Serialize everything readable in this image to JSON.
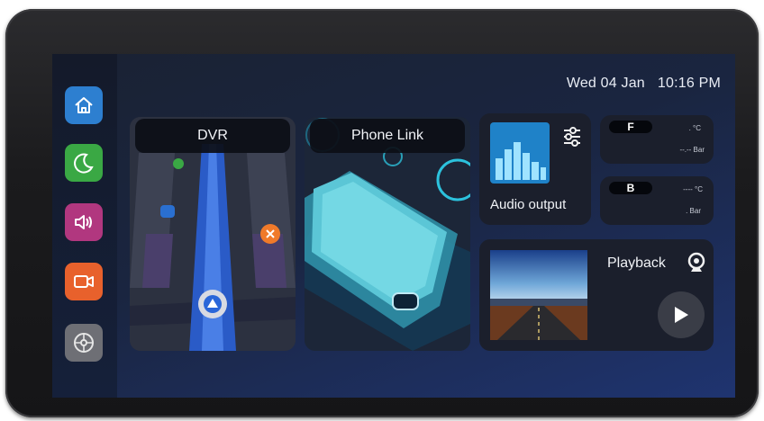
{
  "header": {
    "date": "Wed 04 Jan",
    "time": "10:16 PM"
  },
  "sidebar": {
    "items": [
      {
        "name": "home",
        "icon": "home-icon",
        "color": "#2d7fd0"
      },
      {
        "name": "night-mode",
        "icon": "moon-icon",
        "color": "#3aa844"
      },
      {
        "name": "sound",
        "icon": "speaker-icon",
        "color": "#b1377f"
      },
      {
        "name": "camera",
        "icon": "video-camera-icon",
        "color": "#e8612c"
      },
      {
        "name": "settings",
        "icon": "settings-wheel-icon",
        "color": "#6e6f75"
      }
    ]
  },
  "cards": {
    "dvr": {
      "title": "DVR"
    },
    "phone_link": {
      "title": "Phone Link"
    },
    "audio": {
      "label": "Audio output",
      "icon": "equalizer-sliders-icon"
    },
    "tire_front": {
      "label": "F",
      "temp": ". °C",
      "pressure": "--.-- Bar"
    },
    "tire_back": {
      "label": "B",
      "temp": "---- °C",
      "pressure": ". Bar"
    },
    "playback": {
      "label": "Playback",
      "icon": "webcam-icon",
      "play_icon": "play-icon"
    }
  }
}
